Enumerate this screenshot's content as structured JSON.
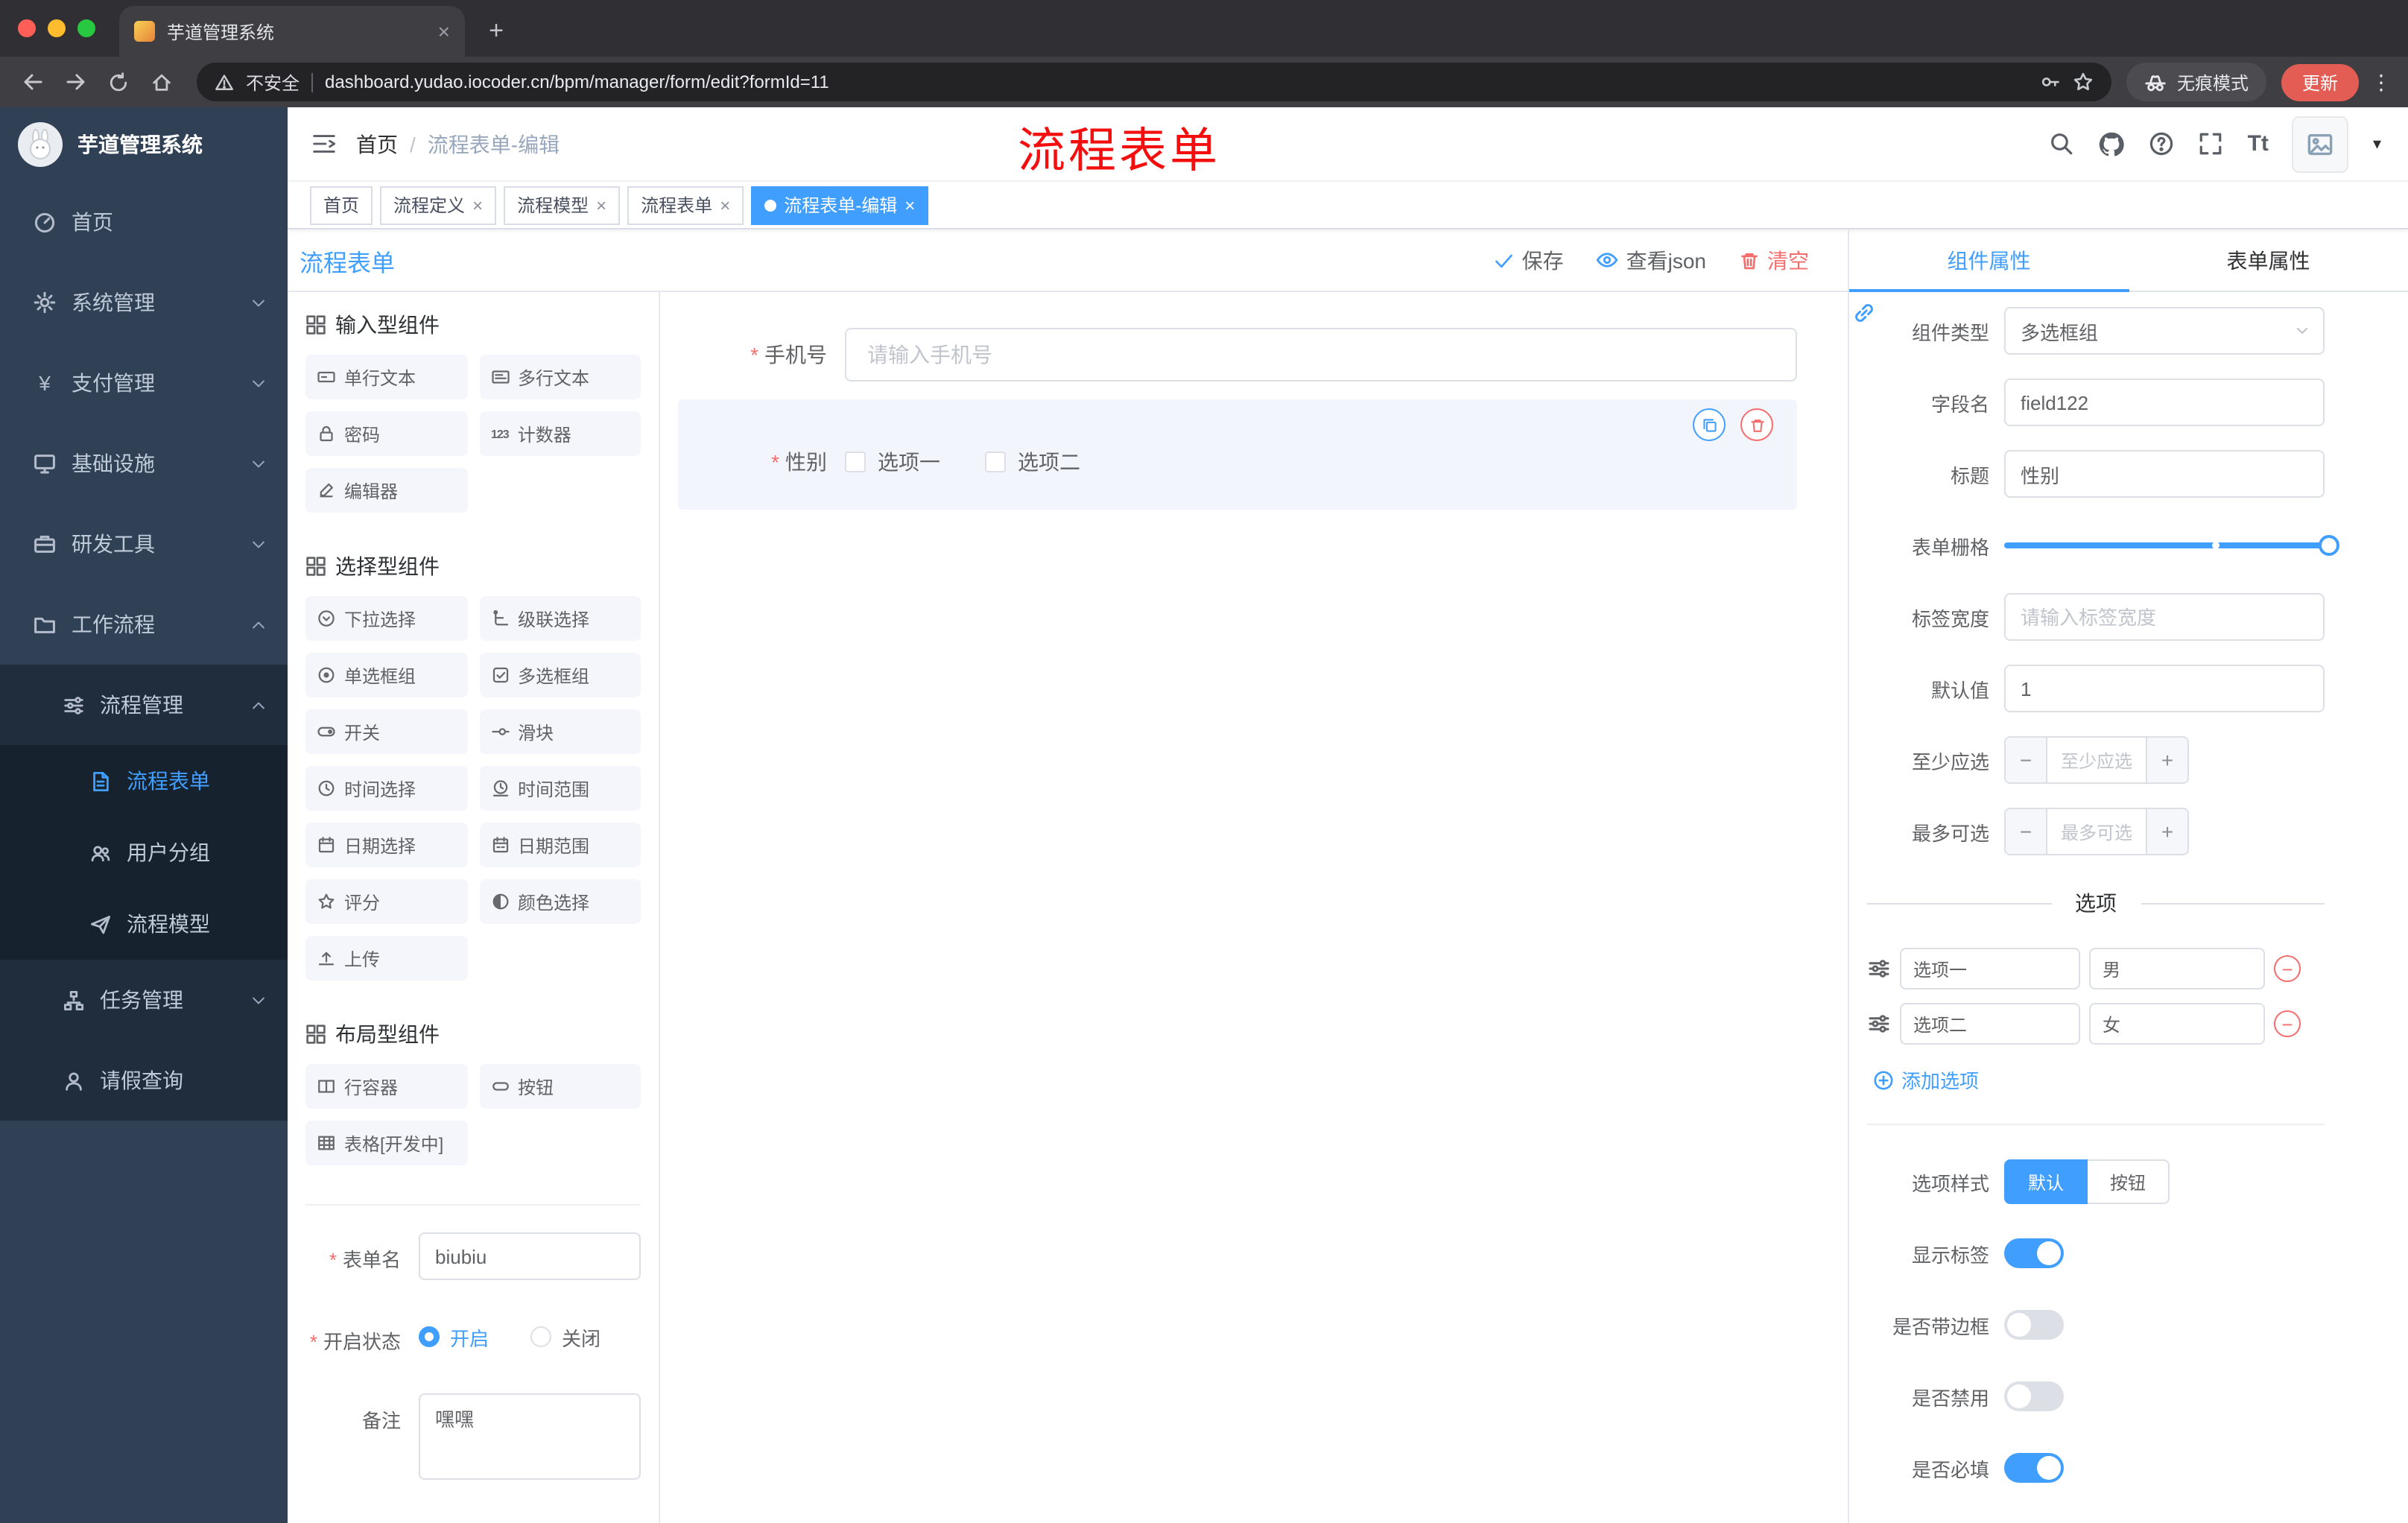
{
  "colors": {
    "accent": "#409eff",
    "danger": "#f56c6c",
    "sidebar_bg": "#304156",
    "submenu_bg": "#1f2d3d",
    "update_pill": "#e35d55",
    "annotation_red": "#f40f0f",
    "active_tag_bg": "#409eff"
  },
  "glyphs": {
    "close": "×",
    "plus": "+",
    "minus": "−",
    "more": "⋮",
    "separator": "/",
    "caret": "▾",
    "font_size": "Tt",
    "yen": "¥",
    "counter": "123"
  },
  "browser": {
    "tab_title": "芋道管理系统",
    "security_label": "不安全",
    "url": "dashboard.yudao.iocoder.cn/bpm/manager/form/edit?formId=11",
    "incognito_label": "无痕模式",
    "update_label": "更新"
  },
  "sidebar": {
    "logo_title": "芋道管理系统",
    "items": [
      {
        "label": "首页"
      },
      {
        "label": "系统管理"
      },
      {
        "label": "支付管理"
      },
      {
        "label": "基础设施"
      },
      {
        "label": "研发工具"
      },
      {
        "label": "工作流程"
      },
      {
        "label": "流程管理"
      },
      {
        "label": "流程表单"
      },
      {
        "label": "用户分组"
      },
      {
        "label": "流程模型"
      },
      {
        "label": "任务管理"
      },
      {
        "label": "请假查询"
      }
    ]
  },
  "navbar": {
    "breadcrumb_home": "首页",
    "breadcrumb_current": "流程表单-编辑",
    "annotation": "流程表单"
  },
  "tags": [
    {
      "label": "首页"
    },
    {
      "label": "流程定义"
    },
    {
      "label": "流程模型"
    },
    {
      "label": "流程表单"
    },
    {
      "label": "流程表单-编辑"
    }
  ],
  "designer": {
    "title": "流程表单",
    "actions": {
      "save": "保存",
      "view_json": "查看json",
      "clear": "清空"
    },
    "palette": {
      "sections": [
        {
          "title": "输入型组件",
          "items": [
            {
              "label": "单行文本"
            },
            {
              "label": "多行文本"
            },
            {
              "label": "密码"
            },
            {
              "label": "计数器"
            },
            {
              "label": "编辑器"
            }
          ]
        },
        {
          "title": "选择型组件",
          "items": [
            {
              "label": "下拉选择"
            },
            {
              "label": "级联选择"
            },
            {
              "label": "单选框组"
            },
            {
              "label": "多选框组"
            },
            {
              "label": "开关"
            },
            {
              "label": "滑块"
            },
            {
              "label": "时间选择"
            },
            {
              "label": "时间范围"
            },
            {
              "label": "日期选择"
            },
            {
              "label": "日期范围"
            },
            {
              "label": "评分"
            },
            {
              "label": "颜色选择"
            },
            {
              "label": "上传"
            }
          ]
        },
        {
          "title": "布局型组件",
          "items": [
            {
              "label": "行容器"
            },
            {
              "label": "按钮"
            },
            {
              "label": "表格[开发中]"
            }
          ]
        }
      ]
    },
    "meta_form": {
      "name_label": "表单名",
      "name_value": "biubiu",
      "status_label": "开启状态",
      "status_on": "开启",
      "status_off": "关闭",
      "remark_label": "备注",
      "remark_value": "嘿嘿"
    },
    "canvas": {
      "phone": {
        "label": "手机号",
        "placeholder": "请输入手机号"
      },
      "gender": {
        "label": "性别",
        "option1": "选项一",
        "option2": "选项二"
      }
    }
  },
  "properties": {
    "tab_component": "组件属性",
    "tab_form": "表单属性",
    "component_type": {
      "label": "组件类型",
      "value": "多选框组"
    },
    "field_name": {
      "label": "字段名",
      "value": "field122"
    },
    "title": {
      "label": "标题",
      "value": "性别"
    },
    "grid": {
      "label": "表单栅格"
    },
    "label_width": {
      "label": "标签宽度",
      "placeholder": "请输入标签宽度"
    },
    "default_value": {
      "label": "默认值",
      "value": "1"
    },
    "min_select": {
      "label": "至少应选",
      "placeholder": "至少应选"
    },
    "max_select": {
      "label": "最多可选",
      "placeholder": "最多可选"
    },
    "options_divider": "选项",
    "options": [
      {
        "label": "选项一",
        "value": "男"
      },
      {
        "label": "选项二",
        "value": "女"
      }
    ],
    "add_option": "添加选项",
    "option_style": {
      "label": "选项样式",
      "default": "默认",
      "button": "按钮"
    },
    "toggles": [
      {
        "label": "显示标签"
      },
      {
        "label": "是否带边框"
      },
      {
        "label": "是否禁用"
      },
      {
        "label": "是否必填"
      }
    ]
  }
}
